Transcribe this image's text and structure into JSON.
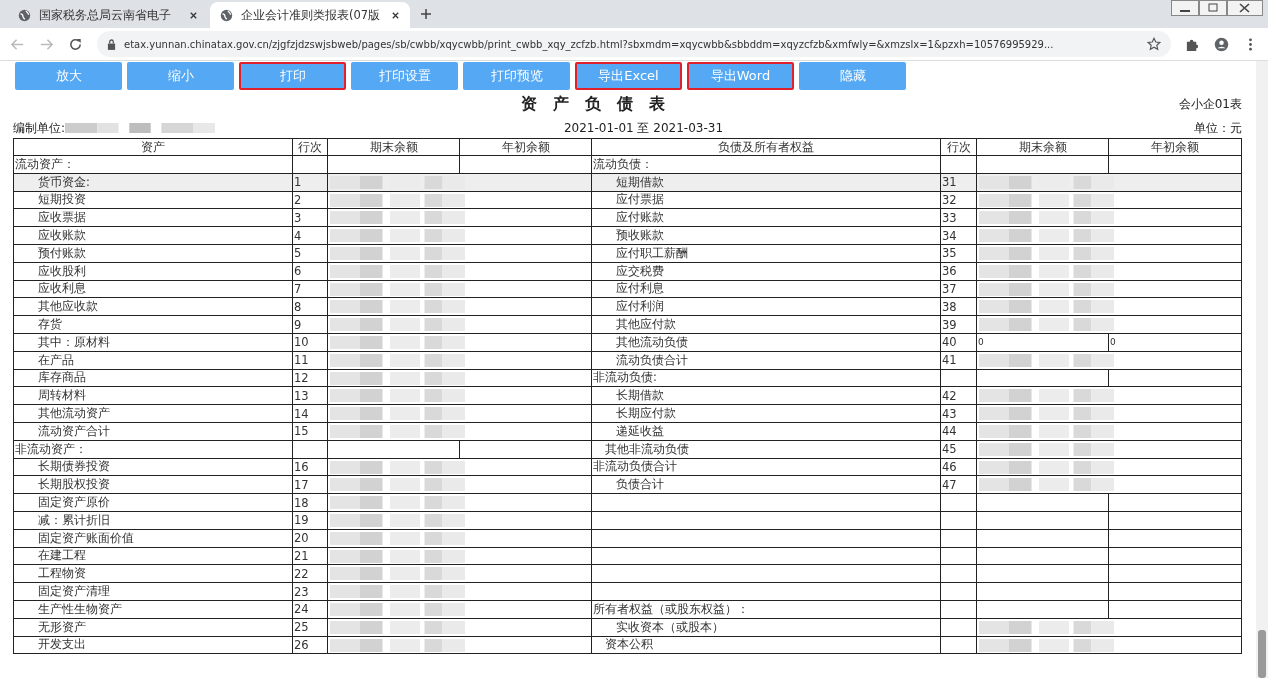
{
  "browser": {
    "tabs": [
      {
        "title": "国家税务总局云南省电子",
        "selected": false
      },
      {
        "title": "企业会计准则类报表(07版",
        "selected": true
      }
    ],
    "url": "etax.yunnan.chinatax.gov.cn/zjgfzjdzswjsbweb/pages/sb/cwbb/xqycwbb/print_cwbb_xqy_zcfzb.html?sbxmdm=xqycwbb&sbbddm=xqyzcfzb&xmfwly=&xmzslx=1&pzxh=10576995929..."
  },
  "toolbar": [
    {
      "label": "放大",
      "highlighted": false
    },
    {
      "label": "缩小",
      "highlighted": false
    },
    {
      "label": "打印",
      "highlighted": true
    },
    {
      "label": "打印设置",
      "highlighted": false
    },
    {
      "label": "打印预览",
      "highlighted": false
    },
    {
      "label": "导出Excel",
      "highlighted": true
    },
    {
      "label": "导出Word",
      "highlighted": true
    },
    {
      "label": "隐藏",
      "highlighted": false
    }
  ],
  "report": {
    "title": "资　产　负　债　表",
    "form_code": "会小企01表",
    "unit_label": "编制单位:",
    "period": "2021-01-01 至 2021-03-31",
    "currency": "单位：元",
    "columns": [
      "资产",
      "行次",
      "期末余额",
      "年初余额",
      "负债及所有者权益",
      "行次",
      "期末余额",
      "年初余额"
    ],
    "rows": [
      {
        "selected": false,
        "left": {
          "label": "流动资产：",
          "kind": "section",
          "masked": false
        },
        "right": {
          "label": "流动负债：",
          "kind": "section",
          "masked": false
        }
      },
      {
        "selected": true,
        "left": {
          "label": "货币资金:",
          "kind": "item",
          "line": "1",
          "masked": true
        },
        "right": {
          "label": "短期借款",
          "kind": "item",
          "line": "31",
          "masked": true
        }
      },
      {
        "selected": false,
        "left": {
          "label": "短期投资",
          "kind": "item",
          "line": "2",
          "masked": true
        },
        "right": {
          "label": "应付票据",
          "kind": "item",
          "line": "32",
          "masked": true
        }
      },
      {
        "selected": false,
        "left": {
          "label": "应收票据",
          "kind": "item",
          "line": "3",
          "masked": true
        },
        "right": {
          "label": "应付账款",
          "kind": "item",
          "line": "33",
          "masked": true
        }
      },
      {
        "selected": false,
        "left": {
          "label": "应收账款",
          "kind": "item",
          "line": "4",
          "masked": true
        },
        "right": {
          "label": "预收账款",
          "kind": "item",
          "line": "34",
          "masked": true
        }
      },
      {
        "selected": false,
        "left": {
          "label": "预付账款",
          "kind": "item",
          "line": "5",
          "masked": true
        },
        "right": {
          "label": "应付职工薪酬",
          "kind": "item",
          "line": "35",
          "masked": true
        }
      },
      {
        "selected": false,
        "left": {
          "label": "应收股利",
          "kind": "item",
          "line": "6",
          "masked": true
        },
        "right": {
          "label": "应交税费",
          "kind": "item",
          "line": "36",
          "masked": true
        }
      },
      {
        "selected": false,
        "left": {
          "label": "应收利息",
          "kind": "item",
          "line": "7",
          "masked": true
        },
        "right": {
          "label": "应付利息",
          "kind": "item",
          "line": "37",
          "masked": true
        }
      },
      {
        "selected": false,
        "left": {
          "label": "其他应收款",
          "kind": "item",
          "line": "8",
          "masked": true
        },
        "right": {
          "label": "应付利润",
          "kind": "item",
          "line": "38",
          "masked": true
        }
      },
      {
        "selected": false,
        "left": {
          "label": "存货",
          "kind": "item",
          "line": "9",
          "masked": true
        },
        "right": {
          "label": "其他应付款",
          "kind": "item",
          "line": "39",
          "masked": true
        }
      },
      {
        "selected": false,
        "left": {
          "label": "其中：原材料",
          "kind": "item",
          "line": "10",
          "masked": true
        },
        "right": {
          "label": "其他流动负债",
          "kind": "item",
          "line": "40",
          "end": "0",
          "begin": "0",
          "masked": false
        }
      },
      {
        "selected": false,
        "left": {
          "label": "在产品",
          "kind": "item",
          "line": "11",
          "masked": true
        },
        "right": {
          "label": "流动负债合计",
          "kind": "item",
          "line": "41",
          "masked": true
        }
      },
      {
        "selected": false,
        "left": {
          "label": "库存商品",
          "kind": "item",
          "line": "12",
          "masked": true
        },
        "right": {
          "label": "非流动负债:",
          "kind": "section",
          "masked": false
        }
      },
      {
        "selected": false,
        "left": {
          "label": "周转材料",
          "kind": "item",
          "line": "13",
          "masked": true
        },
        "right": {
          "label": "长期借款",
          "kind": "item",
          "line": "42",
          "masked": true
        }
      },
      {
        "selected": false,
        "left": {
          "label": "其他流动资产",
          "kind": "item",
          "line": "14",
          "masked": true
        },
        "right": {
          "label": "长期应付款",
          "kind": "item",
          "line": "43",
          "masked": true
        }
      },
      {
        "selected": false,
        "left": {
          "label": "流动资产合计",
          "kind": "item",
          "line": "15",
          "masked": true
        },
        "right": {
          "label": "递延收益",
          "kind": "item",
          "line": "44",
          "masked": true
        }
      },
      {
        "selected": false,
        "left": {
          "label": "非流动资产：",
          "kind": "section",
          "masked": false
        },
        "right": {
          "label": "其他非流动负债",
          "kind": "offset",
          "line": "45",
          "masked": true
        }
      },
      {
        "selected": false,
        "left": {
          "label": "长期债券投资",
          "kind": "item",
          "line": "16",
          "masked": true
        },
        "right": {
          "label": "非流动负债合计",
          "kind": "section",
          "line": "46",
          "masked": true
        }
      },
      {
        "selected": false,
        "left": {
          "label": "长期股权投资",
          "kind": "item",
          "line": "17",
          "masked": true
        },
        "right": {
          "label": "负债合计",
          "kind": "item",
          "line": "47",
          "masked": true
        }
      },
      {
        "selected": false,
        "left": {
          "label": "固定资产原价",
          "kind": "item",
          "line": "18",
          "masked": true
        },
        "right": {
          "kind": "empty",
          "masked": false
        }
      },
      {
        "selected": false,
        "left": {
          "label": "减：累计折旧",
          "kind": "item",
          "line": "19",
          "masked": true
        },
        "right": {
          "kind": "empty",
          "masked": false
        }
      },
      {
        "selected": false,
        "left": {
          "label": "固定资产账面价值",
          "kind": "item",
          "line": "20",
          "masked": true
        },
        "right": {
          "kind": "empty",
          "masked": false
        }
      },
      {
        "selected": false,
        "left": {
          "label": "在建工程",
          "kind": "item",
          "line": "21",
          "masked": true
        },
        "right": {
          "kind": "empty",
          "masked": false
        }
      },
      {
        "selected": false,
        "left": {
          "label": "工程物资",
          "kind": "item",
          "line": "22",
          "masked": true
        },
        "right": {
          "kind": "empty",
          "masked": false
        }
      },
      {
        "selected": false,
        "left": {
          "label": "固定资产清理",
          "kind": "item",
          "line": "23",
          "masked": true
        },
        "right": {
          "kind": "empty",
          "masked": false
        }
      },
      {
        "selected": false,
        "left": {
          "label": "生产性生物资产",
          "kind": "item",
          "line": "24",
          "masked": true
        },
        "right": {
          "label": "所有者权益（或股东权益）：",
          "kind": "section",
          "masked": false
        }
      },
      {
        "selected": false,
        "left": {
          "label": "无形资产",
          "kind": "item",
          "line": "25",
          "masked": true
        },
        "right": {
          "label": "实收资本（或股本）",
          "kind": "item",
          "masked": true
        }
      },
      {
        "selected": false,
        "left": {
          "label": "开发支出",
          "kind": "item",
          "line": "26",
          "masked": true
        },
        "right": {
          "label": "资本公积",
          "kind": "offset",
          "masked": true
        }
      }
    ]
  }
}
